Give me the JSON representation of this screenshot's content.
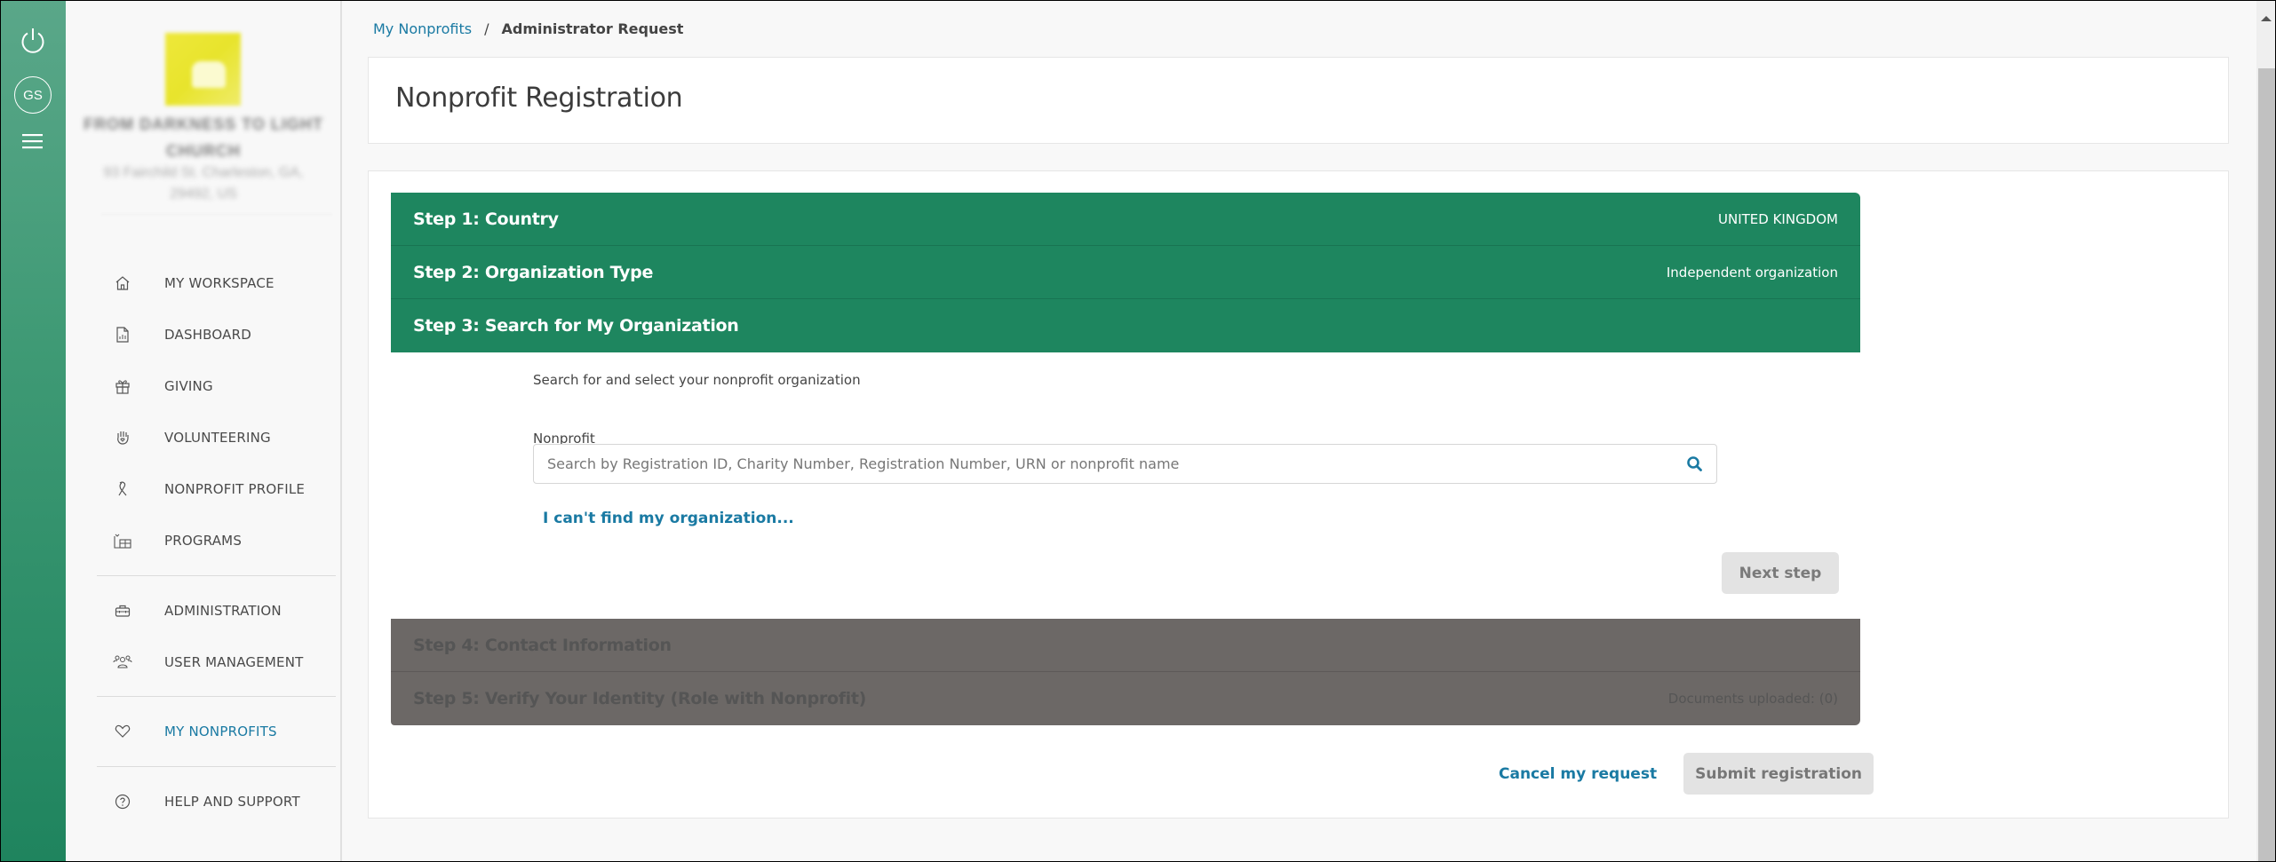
{
  "rail": {
    "avatar_initials": "GS",
    "icons": [
      "power-icon",
      "avatar",
      "hamburger-menu-icon"
    ]
  },
  "organization": {
    "name": "FROM DARKNESS TO LIGHT CHURCH",
    "address": "93 Fairchild St. Charleston, GA, 29492, US"
  },
  "sidebar": {
    "items": [
      {
        "label": "MY WORKSPACE",
        "icon": "home-icon"
      },
      {
        "label": "DASHBOARD",
        "icon": "report-document-icon"
      },
      {
        "label": "GIVING",
        "icon": "gift-icon"
      },
      {
        "label": "VOLUNTEERING",
        "icon": "hand-heart-icon"
      },
      {
        "label": "NONPROFIT PROFILE",
        "icon": "ribbon-icon"
      },
      {
        "label": "PROGRAMS",
        "icon": "programs-icon"
      },
      {
        "label": "ADMINISTRATION",
        "icon": "toolbox-icon"
      },
      {
        "label": "USER MANAGEMENT",
        "icon": "users-icon"
      },
      {
        "label": "MY NONPROFITS",
        "icon": "heart-icon",
        "active": true
      },
      {
        "label": "HELP AND SUPPORT",
        "icon": "help-circle-icon"
      }
    ]
  },
  "breadcrumb": {
    "parent": "My Nonprofits",
    "separator": "/",
    "current": "Administrator Request"
  },
  "page": {
    "title": "Nonprofit Registration"
  },
  "steps": [
    {
      "title": "Step 1: Country",
      "value": "UNITED KINGDOM",
      "state": "complete"
    },
    {
      "title": "Step 2: Organization Type",
      "value": "Independent organization",
      "state": "complete"
    },
    {
      "title": "Step 3: Search for My Organization",
      "value": "",
      "state": "active"
    },
    {
      "title": "Step 4: Contact Information",
      "value": "",
      "state": "disabled"
    },
    {
      "title": "Step 5: Verify Your Identity (Role with Nonprofit)",
      "value": "Documents uploaded: (0)",
      "state": "disabled"
    }
  ],
  "step3": {
    "description": "Search for and select your nonprofit organization",
    "field_label": "Nonprofit",
    "search_value": "",
    "search_placeholder": "Search by Registration ID, Charity Number, Registration Number, URN or nonprofit name",
    "cant_find_link": "I can't find my organization...",
    "next_button": "Next step"
  },
  "footer": {
    "cancel_link": "Cancel my request",
    "submit_button": "Submit registration"
  },
  "colors": {
    "brand_green": "#1e865f",
    "link_blue": "#1a7aa3",
    "disabled_step": "#6c6866",
    "disabled_button": "#e3e3e3"
  }
}
